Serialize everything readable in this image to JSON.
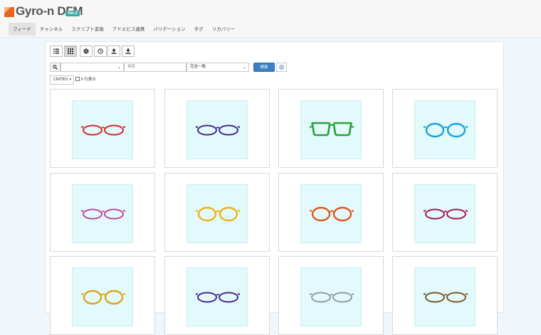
{
  "app": {
    "logo_text": "Gyro-n DFM",
    "version_badge": "Ver.2"
  },
  "nav": [
    {
      "label": "フィード",
      "active": true
    },
    {
      "label": "チャンネル",
      "active": false
    },
    {
      "label": "スクリプト変換",
      "active": false
    },
    {
      "label": "アドエビス連携",
      "active": false
    },
    {
      "label": "バリデーション",
      "active": false
    },
    {
      "label": "タグ",
      "active": false
    },
    {
      "label": "リカバリー",
      "active": false
    }
  ],
  "toolbar": {
    "buttons": [
      {
        "name": "list-view",
        "icon": "list-icon",
        "active": false
      },
      {
        "name": "grid-view",
        "icon": "grid-icon",
        "active": true
      },
      {
        "name": "settings",
        "icon": "gear-icon",
        "active": false
      },
      {
        "name": "history",
        "icon": "clock-icon",
        "active": false
      },
      {
        "name": "upload",
        "icon": "upload-icon",
        "active": false
      },
      {
        "name": "download",
        "icon": "download-icon",
        "active": false
      }
    ]
  },
  "search": {
    "field_select_value": "",
    "keyword_placeholder": "検索",
    "match_select_value": "完全一致",
    "search_button": "検索"
  },
  "filters": {
    "channel_dropdown": "CRITEO",
    "three_rows_label": "3 行表示",
    "three_rows_checked": false
  },
  "colors": {
    "accent": "#3a7fc4",
    "logo_orange": "#e8641d",
    "thumb_bg": "#e2fafc"
  },
  "products": [
    {
      "frame_color": "#d42a2a",
      "lens_shape": "oval"
    },
    {
      "frame_color": "#4b2a8a",
      "lens_shape": "oval"
    },
    {
      "frame_color": "#2aa03a",
      "lens_shape": "square"
    },
    {
      "frame_color": "#1aa3d9",
      "lens_shape": "round"
    },
    {
      "frame_color": "#c04aa0",
      "lens_shape": "oval"
    },
    {
      "frame_color": "#f0b21a",
      "lens_shape": "round"
    },
    {
      "frame_color": "#e0581e",
      "lens_shape": "round"
    },
    {
      "frame_color": "#a8185a",
      "lens_shape": "oval"
    },
    {
      "frame_color": "#e0a41a",
      "lens_shape": "round"
    },
    {
      "frame_color": "#4b2a8a",
      "lens_shape": "oval"
    },
    {
      "frame_color": "#8aa0a8",
      "lens_shape": "oval"
    },
    {
      "frame_color": "#7a5a2a",
      "lens_shape": "oval"
    }
  ]
}
